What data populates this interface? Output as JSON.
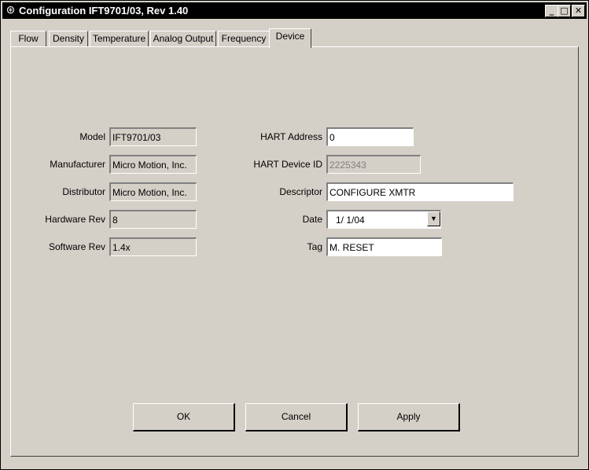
{
  "window": {
    "title": "Configuration IFT9701/03, Rev 1.40",
    "app_icon": "app-icon",
    "controls": {
      "minimize": "_",
      "maximize": "□",
      "close": "✕"
    }
  },
  "tabs": [
    {
      "label": "Flow",
      "active": false
    },
    {
      "label": "Density",
      "active": false
    },
    {
      "label": "Temperature",
      "active": false
    },
    {
      "label": "Analog Output",
      "active": false
    },
    {
      "label": "Frequency",
      "active": false
    },
    {
      "label": "Device",
      "active": true
    }
  ],
  "device": {
    "model": {
      "label": "Model",
      "value": "IFT9701/03"
    },
    "manufacturer": {
      "label": "Manufacturer",
      "value": "Micro Motion, Inc."
    },
    "distributor": {
      "label": "Distributor",
      "value": "Micro Motion, Inc."
    },
    "hardware_rev": {
      "label": "Hardware Rev",
      "value": "8"
    },
    "software_rev": {
      "label": "Software Rev",
      "value": "1.4x"
    },
    "hart_address": {
      "label": "HART Address",
      "value": "0"
    },
    "hart_device_id": {
      "label": "HART Device ID",
      "value": "2225343"
    },
    "descriptor": {
      "label": "Descriptor",
      "value": "CONFIGURE XMTR"
    },
    "date": {
      "label": "Date",
      "value": "1/ 1/04"
    },
    "tag": {
      "label": "Tag",
      "value": "M. RESET"
    }
  },
  "buttons": {
    "ok": "OK",
    "cancel": "Cancel",
    "apply": "Apply"
  }
}
